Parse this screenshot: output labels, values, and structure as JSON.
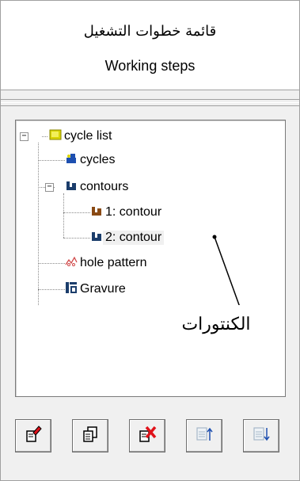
{
  "header": {
    "title_arabic": "قائمة خطوات التشغيل",
    "title_english": "Working steps"
  },
  "tree": {
    "root": {
      "label": "cycle list",
      "icon": "folder-yellow-icon",
      "expander": "−"
    },
    "cycles": {
      "label": "cycles",
      "icon": "cycles-icon"
    },
    "contours": {
      "label": "contours",
      "icon": "contours-icon",
      "expander": "−"
    },
    "contour1": {
      "label": "1: contour",
      "icon": "contour-brown-icon"
    },
    "contour2": {
      "label": "2: contour",
      "icon": "contour-blue-icon"
    },
    "hole_pattern": {
      "label": "hole pattern",
      "icon": "hole-pattern-icon"
    },
    "gravure": {
      "label": "Gravure",
      "icon": "gravure-icon"
    }
  },
  "annotation": {
    "label": "الكنتورات"
  },
  "toolbar": {
    "buttons": [
      {
        "name": "edit",
        "icon": "edit-icon",
        "enabled": true
      },
      {
        "name": "copy",
        "icon": "copy-icon",
        "enabled": true
      },
      {
        "name": "delete",
        "icon": "delete-icon",
        "enabled": true
      },
      {
        "name": "move-up",
        "icon": "move-up-icon",
        "enabled": false
      },
      {
        "name": "move-down",
        "icon": "move-down-icon",
        "enabled": false
      }
    ]
  },
  "colors": {
    "folder_yellow": "#d8d400",
    "contour_blue": "#1b3d6b",
    "contour_brown": "#8a4a14",
    "delete_red": "#e0121a",
    "disabled_gray": "#a7b8c8"
  }
}
